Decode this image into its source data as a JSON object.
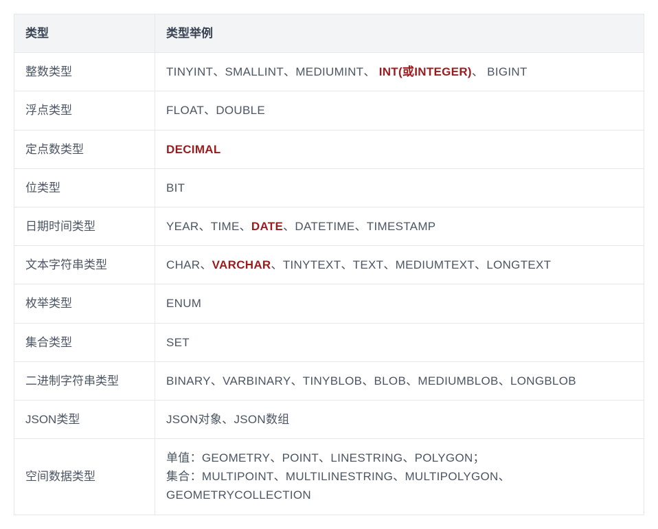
{
  "headers": {
    "col1": "类型",
    "col2": "类型举例"
  },
  "rows": [
    {
      "type": "整数类型",
      "segments": [
        {
          "text": "TINYINT、SMALLINT、MEDIUMINT、 ",
          "hl": false
        },
        {
          "text": "INT(或INTEGER)",
          "hl": true
        },
        {
          "text": "、 BIGINT",
          "hl": false
        }
      ]
    },
    {
      "type": "浮点类型",
      "segments": [
        {
          "text": "FLOAT、DOUBLE",
          "hl": false
        }
      ]
    },
    {
      "type": "定点数类型",
      "segments": [
        {
          "text": "DECIMAL",
          "hl": true
        }
      ]
    },
    {
      "type": "位类型",
      "segments": [
        {
          "text": "BIT",
          "hl": false
        }
      ]
    },
    {
      "type": "日期时间类型",
      "segments": [
        {
          "text": "YEAR、TIME、",
          "hl": false
        },
        {
          "text": "DATE",
          "hl": true
        },
        {
          "text": "、DATETIME、TIMESTAMP",
          "hl": false
        }
      ]
    },
    {
      "type": "文本字符串类型",
      "segments": [
        {
          "text": "CHAR、",
          "hl": false
        },
        {
          "text": "VARCHAR",
          "hl": true
        },
        {
          "text": "、TINYTEXT、TEXT、MEDIUMTEXT、LONGTEXT",
          "hl": false
        }
      ]
    },
    {
      "type": "枚举类型",
      "segments": [
        {
          "text": "ENUM",
          "hl": false
        }
      ]
    },
    {
      "type": "集合类型",
      "segments": [
        {
          "text": "SET",
          "hl": false
        }
      ]
    },
    {
      "type": "二进制字符串类型",
      "segments": [
        {
          "text": "BINARY、VARBINARY、TINYBLOB、BLOB、MEDIUMBLOB、LONGBLOB",
          "hl": false
        }
      ]
    },
    {
      "type": "JSON类型",
      "segments": [
        {
          "text": "JSON对象、JSON数组",
          "hl": false
        }
      ]
    },
    {
      "type": "空间数据类型",
      "segments": [
        {
          "text": "单值：GEOMETRY、POINT、LINESTRING、POLYGON；\n集合：MULTIPOINT、MULTILINESTRING、MULTIPOLYGON、GEOMETRYCOLLECTION",
          "hl": false
        }
      ]
    }
  ]
}
